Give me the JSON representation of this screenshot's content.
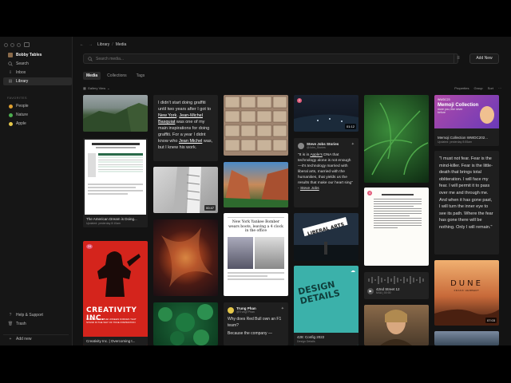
{
  "sidebar": {
    "user": "Bobby Tables",
    "nav": [
      {
        "label": "Search",
        "icon": "search-icon"
      },
      {
        "label": "Inbox",
        "icon": "inbox-icon"
      },
      {
        "label": "Library",
        "icon": "library-icon"
      }
    ],
    "favorites_header": "FAVORITES",
    "favorites": [
      {
        "label": "People",
        "color": "#e0a030"
      },
      {
        "label": "Nature",
        "color": "#4caf50"
      },
      {
        "label": "Apple",
        "color": "#e6c84a"
      }
    ],
    "help": "Help & Support",
    "trash": "Trash",
    "add_new": "Add new"
  },
  "breadcrumb": {
    "root": "Library",
    "sep": "/",
    "current": "Media"
  },
  "search": {
    "placeholder": "Search media..."
  },
  "add_new_button": "Add New",
  "tabs": [
    "Media",
    "Collections",
    "Tags"
  ],
  "view": {
    "label": "Gallery View",
    "properties": "Properties",
    "group": "Group",
    "sort": "Sort",
    "more": "···"
  },
  "cards": {
    "col1": {
      "doc_title": "The American Dream is Doing...",
      "doc_sub": "Updated: yesterday 8:10am",
      "book_title": "Creativity Inc. | Overcoming t...",
      "book_badge": "24",
      "book_cover_title": "CREATIVITY INC.",
      "book_cover_sub": "OVERCOMING THE UNSEEN FORCES THAT STAND IN THE WAY OF TRUE INSPIRATION"
    },
    "col2": {
      "quote_pre1": "I didn't start doing graffiti until two years after I got to ",
      "quote_link1": "New York",
      "quote_mid1": ". ",
      "quote_link2": "Jean-Michel Basquiat",
      "quote_mid2": " was one of my main inspirations for doing graffiti. For a year I didnt know who ",
      "quote_link3": "Jean Michel",
      "quote_end": " was, but I knew his work.",
      "video_dur": "00:47"
    },
    "col3": {
      "article_title": "New York Yankee Bomber wears boots, leaving a 4 clock in the office"
    },
    "col4": {
      "video_dur": "01:12",
      "badge": "2",
      "tweet_name": "Steve Jobs Stories",
      "tweet_handle": "@Jobs_Stories",
      "tweet_text_pre": "\"It is in ",
      "tweet_link1": "Apple's",
      "tweet_text_mid": " DNA that technology alone is not enough—it's technology married with liberal arts, married with the humanities, that yields us the results that make our heart sing\" - ",
      "tweet_link2": "Steve Jobs",
      "sign_text": "LIBERAL ARTS",
      "design_text": "DESIGN DETAILS",
      "design_title": "428: Config 2022",
      "design_sub": "Design Details",
      "tweet2_name": "Trung Phan",
      "tweet2_handle": "@TrungTPhan",
      "tweet2_text": "Why does Red Bull own an F1 team?",
      "tweet2_text2": "Because the company —"
    },
    "col5": {
      "paper_badge": "4",
      "audio_title": "42nd Street 12",
      "audio_sub": "M4A | 00:00"
    },
    "col6": {
      "memoji_title": "Memoji Collection WWDC202...",
      "memoji_sub": "Updated: yesterday 8:55am",
      "memoji_overlay": "Memoji Collection",
      "memoji_overlay_sub": "more you, like never before",
      "memoji_brand": "WWDC23",
      "quote": "\"I must not fear. Fear is the mind-killer. Fear is the little-death that brings total obliteration. I will face my fear. I will permit it to pass over me and through me. And when it has gone past, I will turn the inner eye to see its path. Where the fear has gone there will be nothing. Only I will remain.\"",
      "dune_title": "DUNE",
      "dune_author": "FRANK HERBERT",
      "dune_dur": "07:03"
    }
  },
  "colors": {
    "bg": "#131313",
    "sidebar": "#161616",
    "card": "#202020",
    "accent_link": "#ffffff"
  }
}
